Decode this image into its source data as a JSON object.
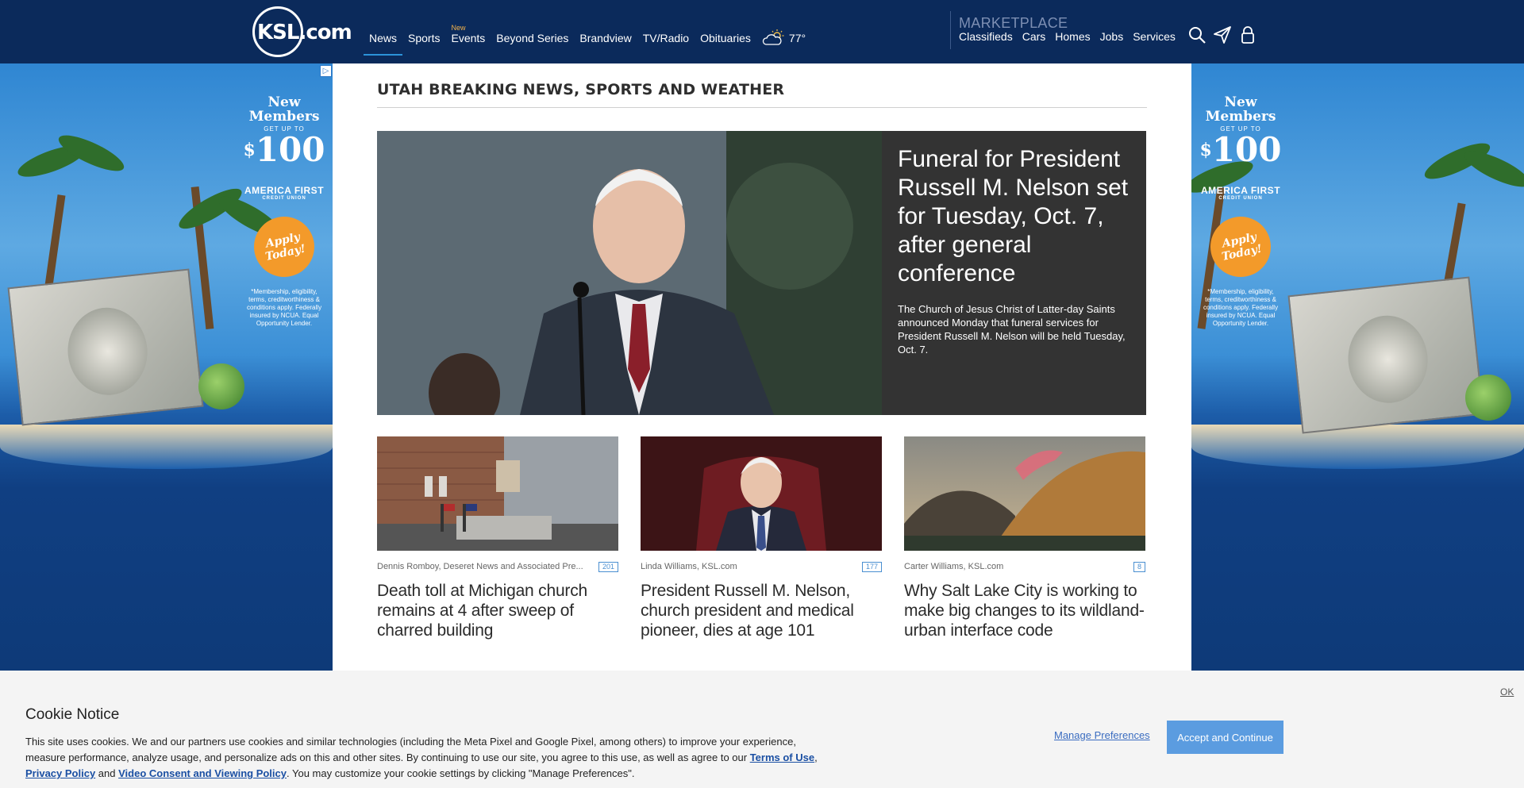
{
  "header": {
    "logo": "KSL.com",
    "nav": [
      {
        "label": "News",
        "active": true
      },
      {
        "label": "Sports"
      },
      {
        "label": "Events",
        "badge": "New"
      },
      {
        "label": "Beyond Series"
      },
      {
        "label": "Brandview"
      },
      {
        "label": "TV/Radio"
      },
      {
        "label": "Obituaries"
      }
    ],
    "weather": {
      "temp": "77°",
      "icon": "partly-cloudy-icon"
    },
    "marketplace": {
      "title": "MARKETPLACE",
      "links": [
        "Classifieds",
        "Cars",
        "Homes",
        "Jobs",
        "Services"
      ]
    },
    "icons": [
      "search-icon",
      "send-icon",
      "user-icon"
    ]
  },
  "ad": {
    "line1": "New",
    "line2": "Members",
    "get_up_to": "GET UP TO",
    "amount": "100",
    "currency": "$",
    "brand": "AMERICA FIRST",
    "brand_sub": "CREDIT UNION",
    "cta": "Apply Today!",
    "fine_print": "*Membership, eligibility, terms, creditworthiness & conditions apply. Federally insured by NCUA. Equal Opportunity Lender."
  },
  "main": {
    "section_title": "UTAH BREAKING NEWS, SPORTS AND WEATHER",
    "hero": {
      "title": "Funeral for President Russell M. Nelson set for Tuesday, Oct. 7, after general conference",
      "description": "The Church of Jesus Christ of Latter-day Saints announced Monday that funeral services for President Russell M. Nelson will be held Tuesday, Oct. 7."
    },
    "cards": [
      {
        "author": "Dennis Romboy, Deseret News and Associated Pre...",
        "comments": "201",
        "title": "Death toll at Michigan church remains at 4 after sweep of charred building"
      },
      {
        "author": "Linda Williams, KSL.com",
        "comments": "177",
        "title": "President Russell M. Nelson, church president and medical pioneer, dies at age 101"
      },
      {
        "author": "Carter Williams, KSL.com",
        "comments": "8",
        "title": "Why Salt Lake City is working to make big changes to its wildland-urban interface code"
      }
    ]
  },
  "cookie": {
    "title": "Cookie Notice",
    "body_1": "This site uses cookies. We and our partners use cookies and similar technologies (including the Meta Pixel and Google Pixel, among others) to improve your experience, measure performance, analyze usage, and personalize ads on this and other sites. By continuing to use our site, you agree to this use, as well as agree to our ",
    "terms_link": "Terms of Use",
    "body_2": ",",
    "privacy_link": "Privacy Policy",
    "body_3": " and ",
    "video_link": "Video Consent and Viewing Policy",
    "body_4": ". You may customize your cookie settings by clicking \"Manage Preferences\".",
    "manage_label": "Manage Preferences",
    "accept_label": "Accept and Continue",
    "ok_label": "OK"
  }
}
